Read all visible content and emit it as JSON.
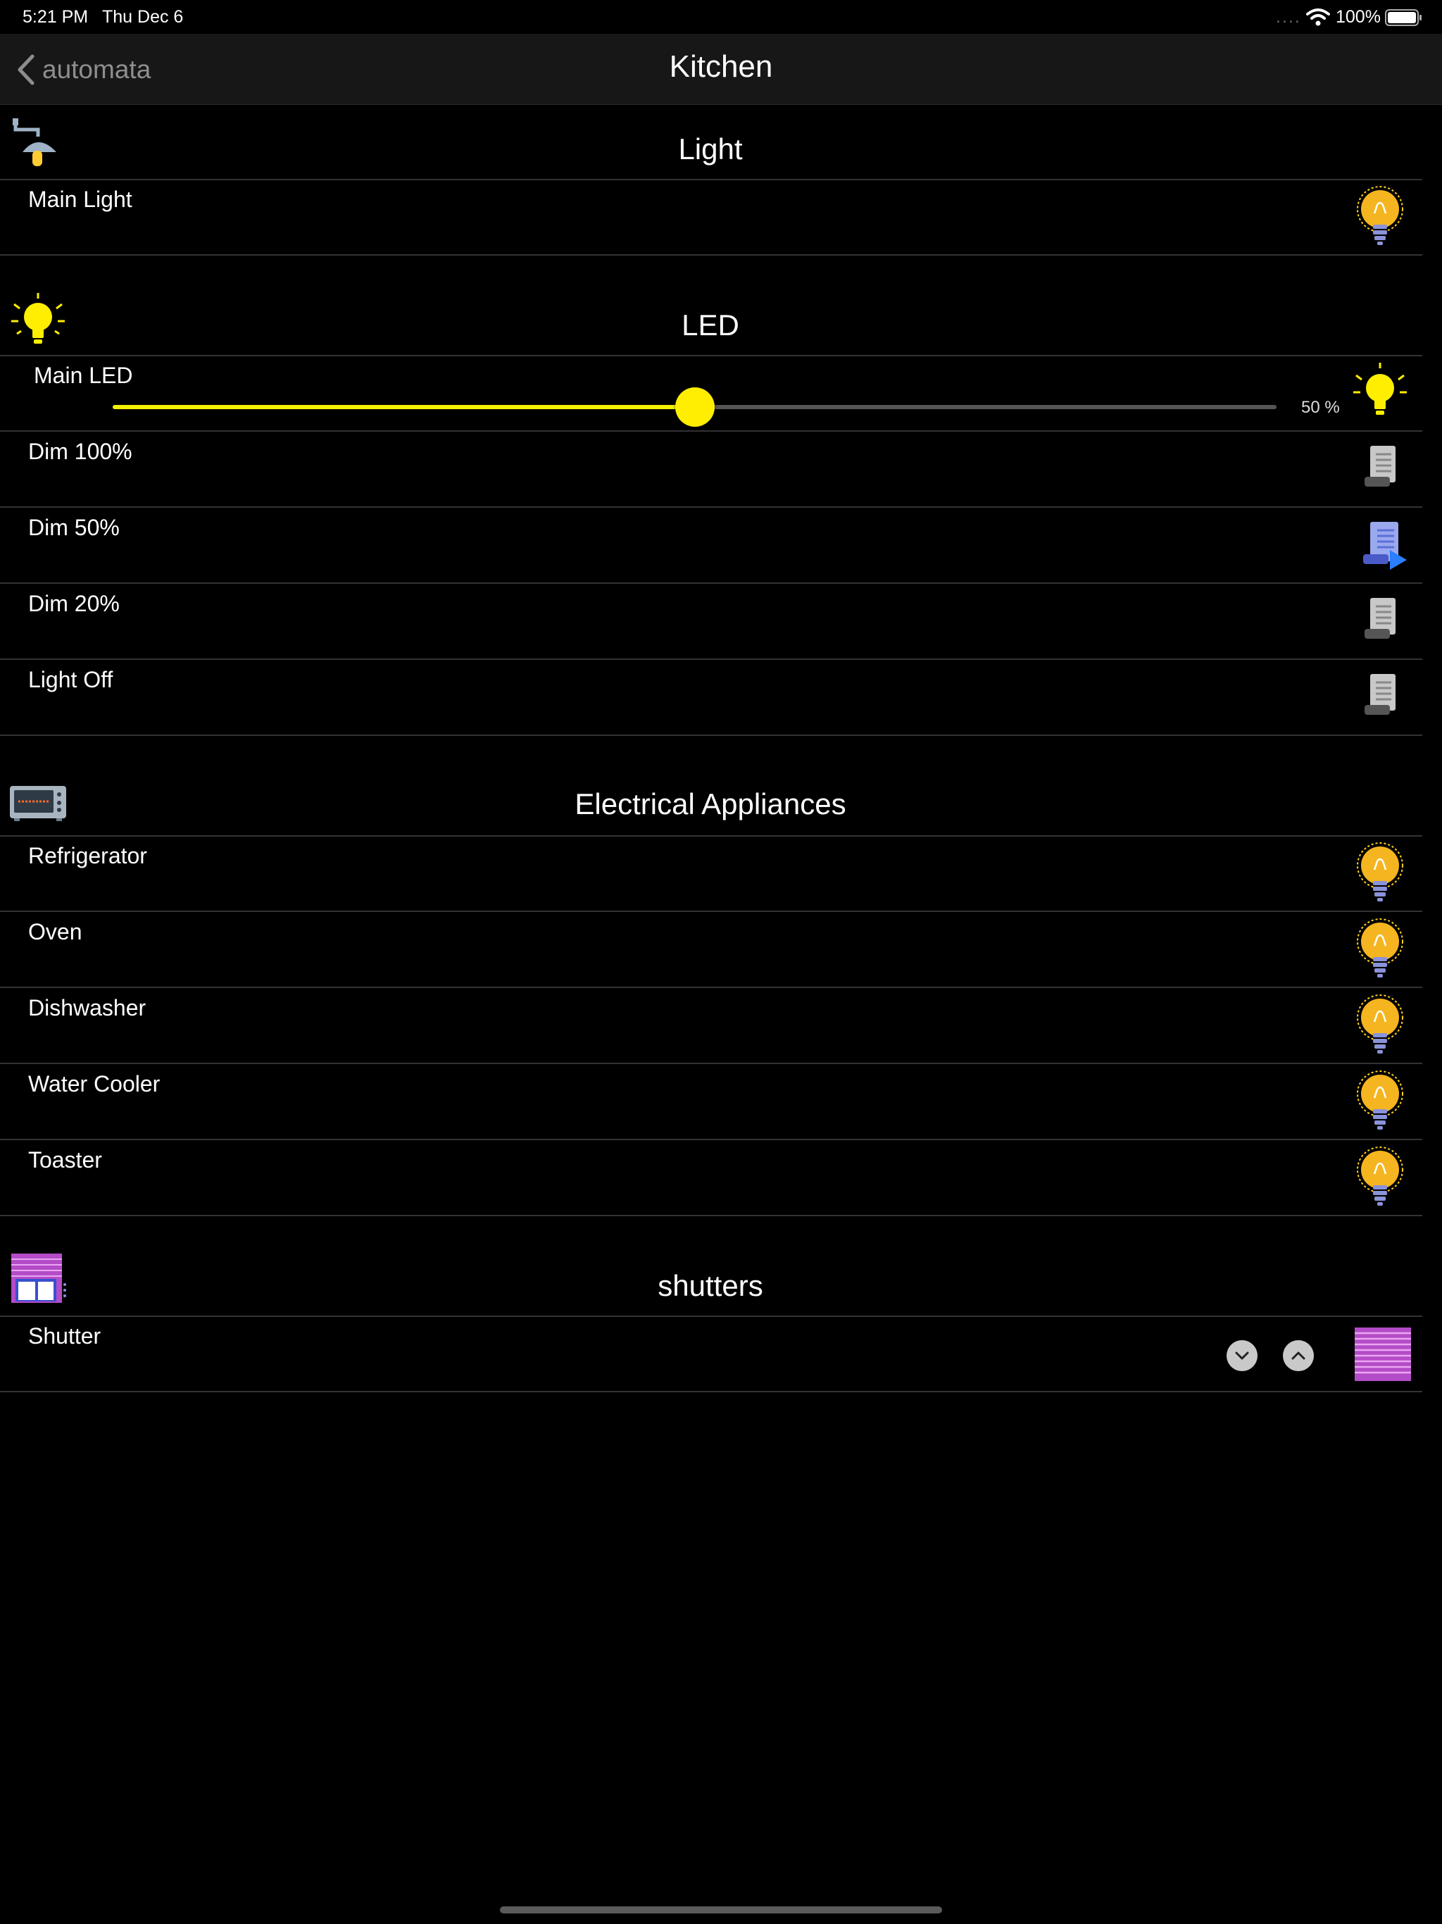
{
  "status_bar": {
    "time": "5:21 PM",
    "date": "Thu Dec 6",
    "dots": "....",
    "battery": "100%"
  },
  "navbar": {
    "back_label": "automata",
    "title": "Kitchen"
  },
  "sections": {
    "light": {
      "title": "Light",
      "icon": "lamp-icon",
      "rows": [
        "Main Light"
      ]
    },
    "led": {
      "title": "LED",
      "icon": "lightbulb-icon",
      "main_led": {
        "label": "Main LED",
        "value_pct": 50,
        "value_text": "50 %"
      },
      "rows": [
        "Dim 100%",
        "Dim 50%",
        "Dim 20%",
        "Light Off"
      ]
    },
    "appliances": {
      "title": "Electrical Appliances",
      "icon": "toaster-oven-icon",
      "rows": [
        "Refrigerator",
        "Oven",
        "Dishwasher",
        "Water Cooler",
        "Toaster"
      ]
    },
    "shutters": {
      "title": "shutters",
      "icon": "shutters-icon",
      "rows": [
        "Shutter"
      ]
    }
  },
  "colors": {
    "accent": "#ffee00",
    "bulb": "#f5b520",
    "script_active": "#6b7fe0",
    "shutter": "#b44cc8"
  }
}
